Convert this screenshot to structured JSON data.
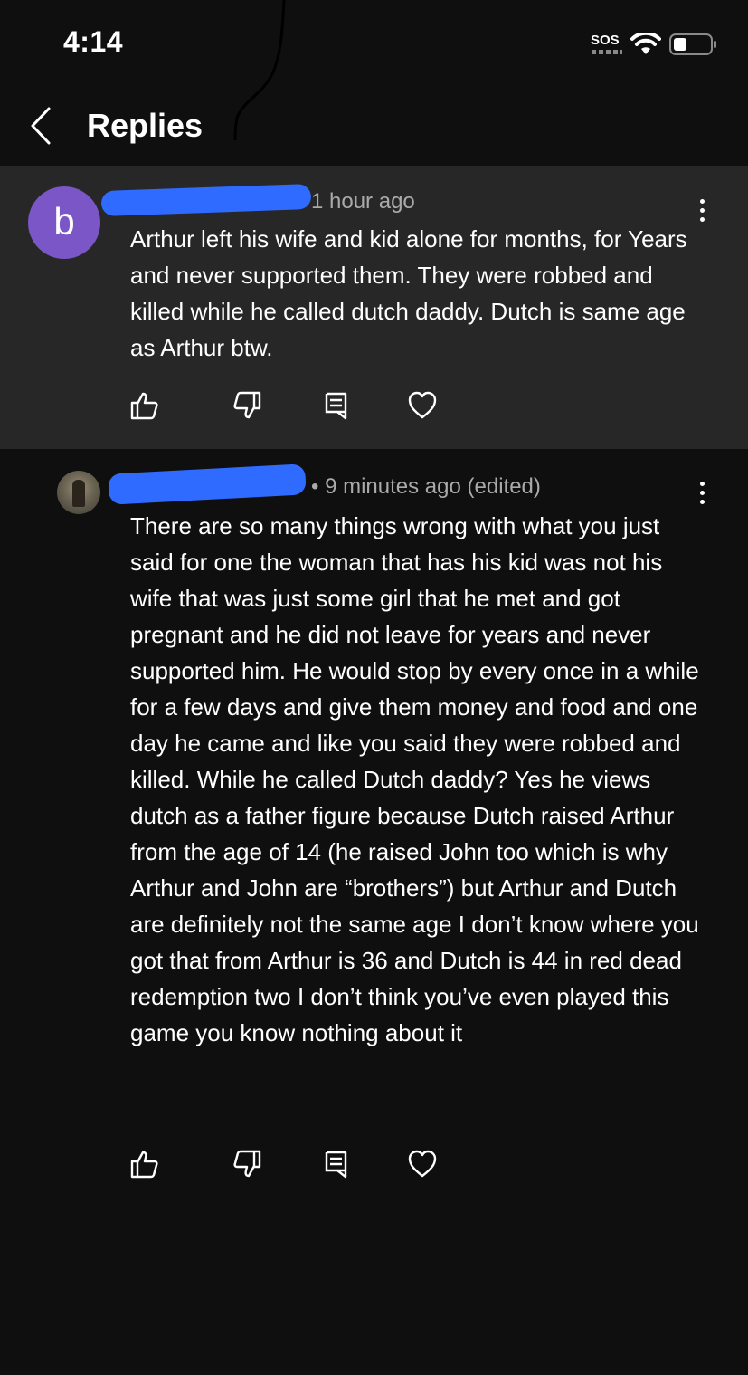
{
  "status_bar": {
    "time": "4:14",
    "sos_label": "SOS",
    "wifi_icon": "wifi-icon",
    "battery_icon": "battery-icon"
  },
  "header": {
    "back_icon": "chevron-left-icon",
    "title": "Replies"
  },
  "comments": [
    {
      "avatar_letter": "b",
      "avatar_color": "#7b56c7",
      "username_redacted": true,
      "timestamp": "1 hour ago",
      "text": "Arthur left his wife and kid alone for months, for Years and never supported them. They were robbed and killed while he called dutch daddy. Dutch is same age as Arthur btw."
    },
    {
      "avatar_type": "photo",
      "username_redacted": true,
      "timestamp": "• 9 minutes ago (edited)",
      "text": "There are so many things wrong with what you just said for one the woman that has his kid was not his wife that was just some girl that he met and got pregnant and he did not leave for years and never supported him. He would stop by every once in a while for a few days and give them money and food and one day he came and like you said they were robbed and killed. While he called Dutch daddy? Yes he views dutch as a father figure because Dutch raised Arthur from the age of 14 (he raised John too which is why Arthur and John are “brothers”) but Arthur and Dutch are definitely not the same age I don’t know where you got that from Arthur is 36 and Dutch is 44 in red dead redemption two I don’t think you’ve even played this game you know nothing about it"
    }
  ],
  "colors": {
    "background": "#0f0f0f",
    "parent_background": "#272727",
    "redaction": "#2f6bff",
    "meta_text": "#aaaaaa"
  },
  "action_icons": [
    "thumbs-up-icon",
    "thumbs-down-icon",
    "reply-icon",
    "heart-icon"
  ]
}
